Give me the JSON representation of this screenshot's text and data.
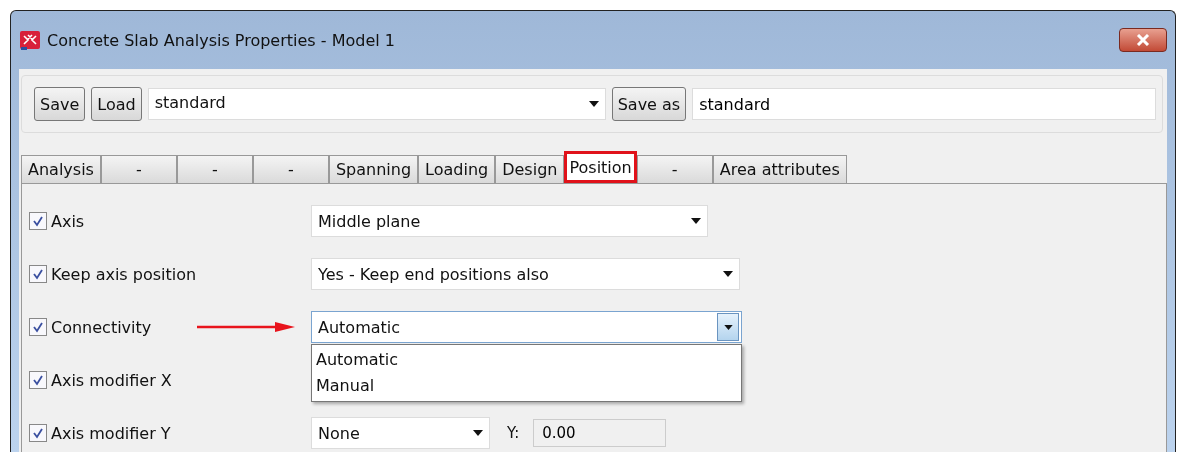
{
  "window": {
    "title": "Concrete Slab Analysis Properties - Model 1"
  },
  "toolbar": {
    "save": "Save",
    "load": "Load",
    "preset": "standard",
    "save_as": "Save as",
    "name": "standard"
  },
  "tabs": [
    {
      "label": "Analysis",
      "selected": false,
      "marked": false
    },
    {
      "label": "-",
      "selected": false,
      "marked": false
    },
    {
      "label": "-",
      "selected": false,
      "marked": false
    },
    {
      "label": "-",
      "selected": false,
      "marked": false
    },
    {
      "label": "Spanning",
      "selected": false,
      "marked": false
    },
    {
      "label": "Loading",
      "selected": false,
      "marked": false
    },
    {
      "label": "Design",
      "selected": false,
      "marked": false
    },
    {
      "label": "Position",
      "selected": true,
      "marked": true
    },
    {
      "label": "-",
      "selected": false,
      "marked": false
    },
    {
      "label": "Area attributes",
      "selected": false,
      "marked": false
    }
  ],
  "rows": [
    {
      "label": "Axis",
      "checked": true,
      "kind": "dropdown",
      "value": "Middle plane",
      "open": false,
      "pointer": false
    },
    {
      "label": "Keep axis position",
      "checked": true,
      "kind": "dropdown",
      "value": "Yes - Keep end positions also",
      "open": false,
      "pointer": false
    },
    {
      "label": "Connectivity",
      "checked": true,
      "kind": "dropdown",
      "value": "Automatic",
      "open": true,
      "pointer": true,
      "options": [
        "Automatic",
        "Manual"
      ]
    },
    {
      "label": "Axis modifier X",
      "checked": true,
      "kind": "hidden",
      "pointer": false
    },
    {
      "label": "Axis modifier Y",
      "checked": true,
      "kind": "dropdown_with_field",
      "value": "None",
      "open": false,
      "pointer": false,
      "field_label": "Y:",
      "field_value": "0.00"
    }
  ]
}
